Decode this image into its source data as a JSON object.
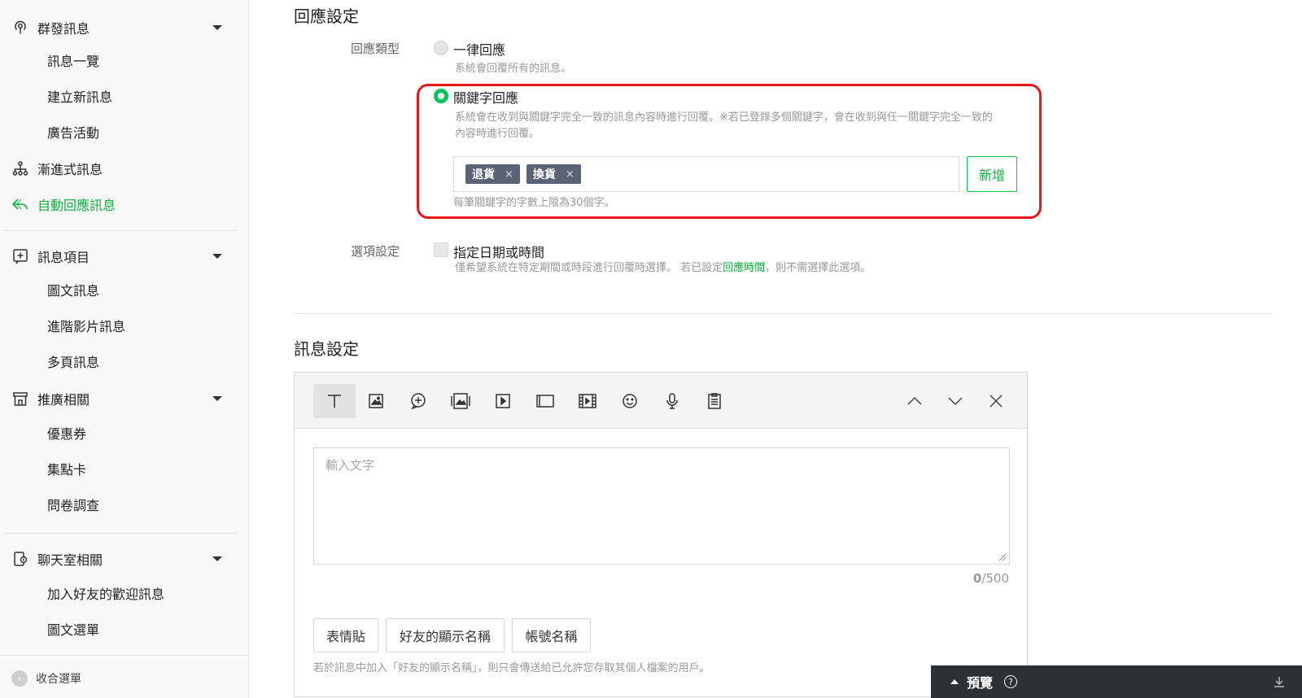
{
  "sidebar": {
    "groups": {
      "broadcast": {
        "label": "群發訊息",
        "icon": "broadcast-icon"
      },
      "stepped": {
        "label": "漸進式訊息",
        "icon": "hierarchy-icon"
      },
      "autoreply": {
        "label": "自動回應訊息",
        "icon": "reply-arrow-icon"
      },
      "message_items": {
        "label": "訊息項目",
        "icon": "plus-square-icon"
      },
      "promotion": {
        "label": "推廣相關",
        "icon": "shop-icon"
      },
      "chat": {
        "label": "聊天室相關",
        "icon": "chat-device-icon"
      }
    },
    "broadcast_items": [
      "訊息一覽",
      "建立新訊息",
      "廣告活動"
    ],
    "message_items": [
      "圖文訊息",
      "進階影片訊息",
      "多頁訊息"
    ],
    "promotion_items": [
      "優惠券",
      "集點卡",
      "問卷調查"
    ],
    "chat_items": [
      "加入好友的歡迎訊息",
      "圖文選單"
    ],
    "collapse_label": "收合選單"
  },
  "reply_settings": {
    "title": "回應設定",
    "type_label": "回應類型",
    "option_all": {
      "label": "一律回應",
      "help": "系統會回覆所有的訊息。",
      "selected": false
    },
    "option_keyword": {
      "label": "關鍵字回應",
      "help_line1": "系統會在收到與關鍵字完全一致的訊息內容時進行回覆。※若已登錄多個關鍵字，會在收到與任一關鍵字完全一致的",
      "help_line2": "內容時進行回覆。",
      "selected": true
    },
    "keywords": [
      {
        "text": "退貨",
        "remove": "×"
      },
      {
        "text": "換貨",
        "remove": "×"
      }
    ],
    "add_button": "新增",
    "keyword_limit": "每筆關鍵字的字數上限為30個字。",
    "option_settings_label": "選項設定",
    "date_option": {
      "label": "指定日期或時間",
      "help_prefix": "僅希望系統在特定期間或時段進行回覆時選擇。 若已設定",
      "help_link": "回應時間",
      "help_suffix": "，則不需選擇此選項。"
    }
  },
  "message_settings": {
    "title": "訊息設定",
    "toolbar": [
      "text-icon",
      "image-icon",
      "sticker-icon",
      "rich-image-icon",
      "video-icon",
      "card-icon",
      "rich-video-icon",
      "emoji-icon",
      "microphone-icon",
      "clipboard-icon"
    ],
    "text_placeholder": "輸入文字",
    "counter_current": "0",
    "counter_max": "/500",
    "insert_buttons": [
      "表情貼",
      "好友的顯示名稱",
      "帳號名稱"
    ],
    "help": "若於訊息中加入「好友的顯示名稱」，則只會傳送給已允許您存取其個人檔案的用戶。"
  },
  "preview": {
    "label": "預覽",
    "help_glyph": "?"
  },
  "colors": {
    "accent_green": "#06c755",
    "highlight_red": "#e8161b",
    "tag_bg": "#5a6375"
  }
}
